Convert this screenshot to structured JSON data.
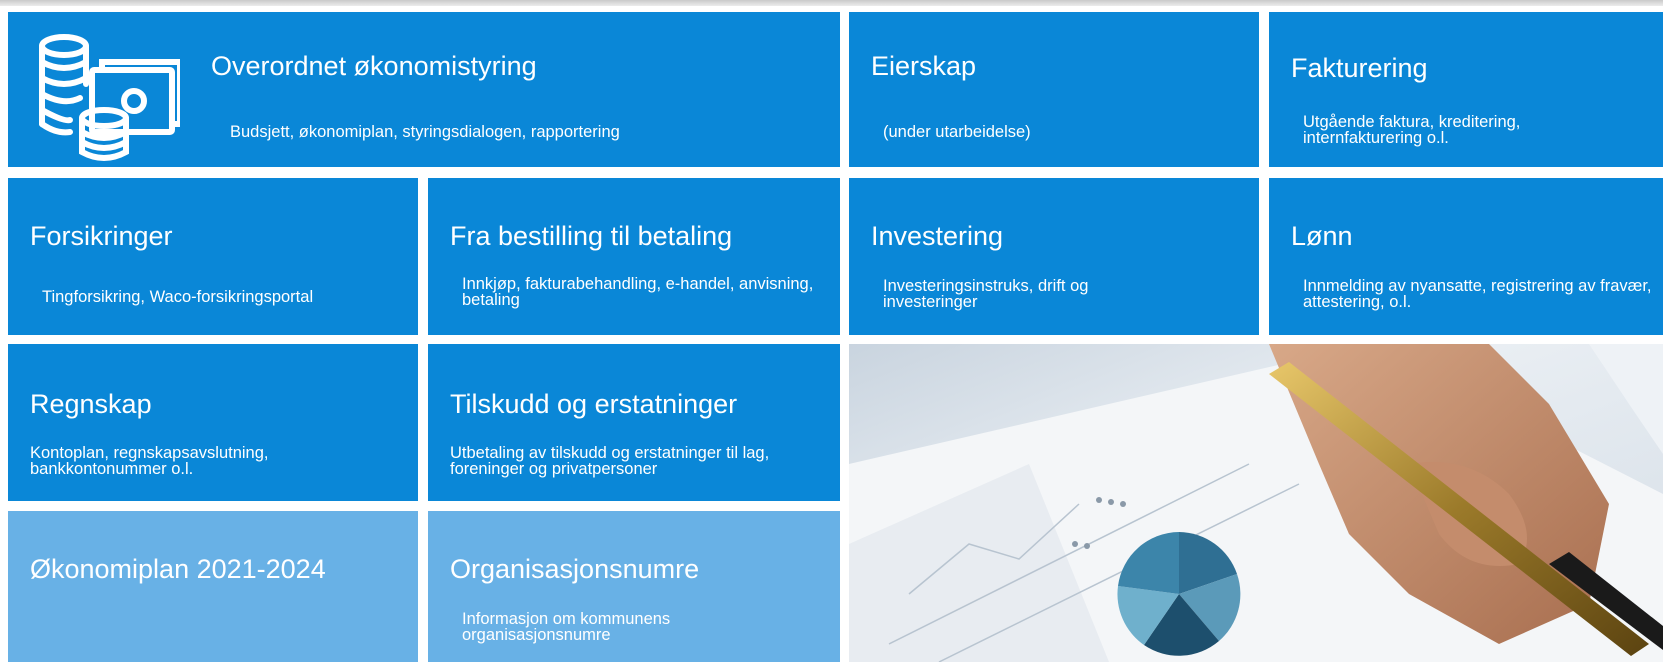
{
  "tiles": {
    "overordnet": {
      "title": "Overordnet økonomistyring",
      "desc": "Budsjett, økonomiplan, styringsdialogen, rapportering"
    },
    "eierskap": {
      "title": "Eierskap",
      "desc": "(under utarbeidelse)"
    },
    "fakturering": {
      "title": "Fakturering",
      "desc": "Utgående faktura, kreditering, internfakturering o.l."
    },
    "forsikringer": {
      "title": "Forsikringer",
      "desc": "Tingforsikring, Waco-forsikringsportal"
    },
    "bestilling": {
      "title": "Fra bestilling til betaling",
      "desc": "Innkjøp, fakturabehandling, e-handel, anvisning, betaling"
    },
    "investering": {
      "title": "Investering",
      "desc": "Investeringsinstruks, drift og investeringer"
    },
    "lonn": {
      "title": "Lønn",
      "desc": "Innmelding av nyansatte, registrering av fravær, attestering, o.l."
    },
    "regnskap": {
      "title": "Regnskap",
      "desc": "Kontoplan, regnskapsavslutning, bankkontonummer o.l."
    },
    "tilskudd": {
      "title": "Tilskudd og erstatninger",
      "desc": "Utbetaling av tilskudd og erstatninger til lag, foreninger og privatpersoner"
    },
    "okonomiplan": {
      "title": "Økonomiplan 2021-2024"
    },
    "orgnr": {
      "title": "Organisasjonsnumre",
      "desc": "Informasjon om kommunens organisasjonsnumre"
    }
  },
  "icons": {
    "coins": "coins-money-icon"
  },
  "colors": {
    "tile_blue": "#0a87d7",
    "tile_light_blue": "#68b1e6",
    "text": "#ffffff"
  }
}
